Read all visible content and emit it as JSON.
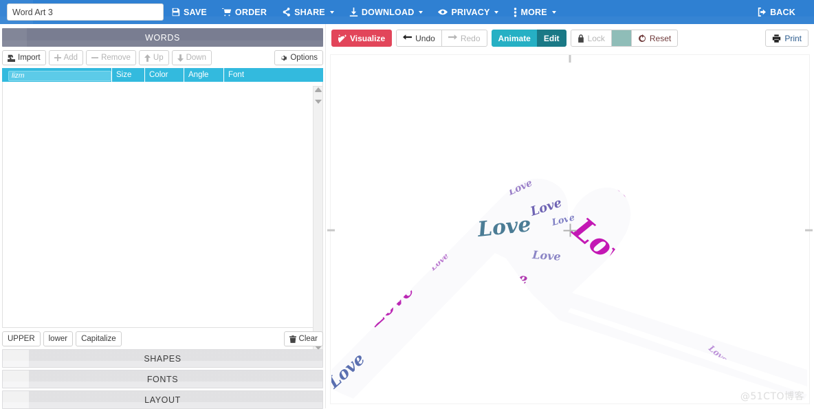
{
  "topbar": {
    "title_value": "Word Art 3",
    "title_placeholder": "Word Art 3",
    "items": [
      {
        "id": "save",
        "label": "SAVE",
        "icon": "floppy-disk-icon",
        "caret": false
      },
      {
        "id": "order",
        "label": "ORDER",
        "icon": "shopping-cart-icon",
        "caret": false
      },
      {
        "id": "share",
        "label": "SHARE",
        "icon": "share-nodes-icon",
        "caret": true
      },
      {
        "id": "download",
        "label": "DOWNLOAD",
        "icon": "download-arrow-icon",
        "caret": true
      },
      {
        "id": "privacy",
        "label": "PRIVACY",
        "icon": "eye-icon",
        "caret": true
      },
      {
        "id": "more",
        "label": "MORE",
        "icon": "vertical-dots-icon",
        "caret": true
      }
    ],
    "back_label": "BACK",
    "back_icon": "sign-out-icon",
    "bg_color": "#2f80d2"
  },
  "left_panel": {
    "words_header": "WORDS",
    "word_toolbar": [
      {
        "id": "import",
        "label": "Import",
        "icon": "import-icon",
        "disabled": false
      },
      {
        "id": "add",
        "label": "Add",
        "icon": "plus-icon",
        "disabled": true
      },
      {
        "id": "remove",
        "label": "Remove",
        "icon": "minus-icon",
        "disabled": true
      },
      {
        "id": "up",
        "label": "Up",
        "icon": "arrow-up-icon",
        "disabled": true
      },
      {
        "id": "down",
        "label": "Down",
        "icon": "arrow-down-icon",
        "disabled": true
      }
    ],
    "options_label": "Options",
    "options_icon": "gear-icon",
    "columns": {
      "word_value": "lizm",
      "word_placeholder": "lizm",
      "size": "Size",
      "color": "Color",
      "angle": "Angle",
      "font": "Font"
    },
    "case_buttons": [
      {
        "id": "upper",
        "label": "UPPER"
      },
      {
        "id": "lower",
        "label": "lower"
      },
      {
        "id": "capitalize",
        "label": "Capitalize"
      }
    ],
    "clear_label": "Clear",
    "clear_icon": "trash-icon",
    "sections": [
      {
        "id": "shapes",
        "label": "SHAPES"
      },
      {
        "id": "fonts",
        "label": "FONTS"
      },
      {
        "id": "layout",
        "label": "LAYOUT"
      }
    ],
    "header_color": "#7b7f93",
    "accent_color": "#33bade"
  },
  "right_panel": {
    "toolbar": {
      "visualize_label": "Visualize",
      "visualize_icon": "magic-wand-icon",
      "visualize_color": "#e2455a",
      "undo_label": "Undo",
      "undo_icon": "arrow-left-icon",
      "redo_label": "Redo",
      "redo_icon": "arrow-right-icon",
      "animate_label": "Animate",
      "animate_color": "#26b0c4",
      "edit_label": "Edit",
      "edit_color": "#1a7986",
      "lock_label": "Lock",
      "lock_icon": "padlock-icon",
      "swatch_color": "#8fbdb8",
      "reset_label": "Reset",
      "reset_icon": "circular-arrow-icon",
      "print_label": "Print",
      "print_icon": "printer-icon"
    },
    "canvas": {
      "word": "Love",
      "shape": "hands-forming-heart",
      "palette": [
        "#c318b4",
        "#a82fb7",
        "#8a4fb5",
        "#6f5fb0",
        "#4a7a9b",
        "#3b6e86",
        "#d14fc6",
        "#b77fd6",
        "#7a8fc9"
      ]
    },
    "watermark": "@51CTO博客"
  }
}
